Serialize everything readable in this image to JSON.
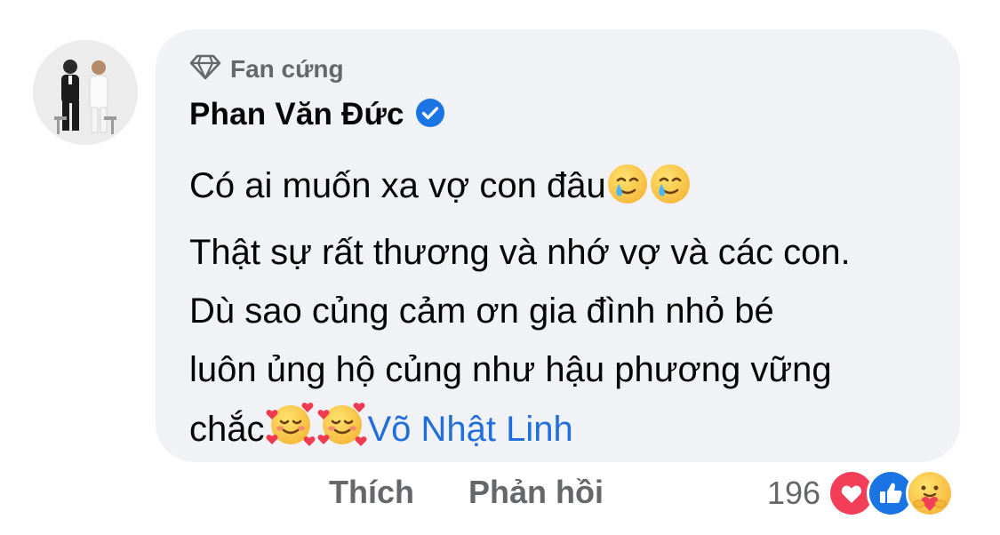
{
  "comment": {
    "badge_label": "Fan cứng",
    "author_name": "Phan Văn Đức",
    "verified": true,
    "lines": [
      "Có ai muốn xa vợ con đâu",
      "Thật sự rất thương và nhớ vợ và các con.",
      "Dù sao củng cảm ơn gia đình nhỏ bé",
      "luôn ủng hộ củng như hậu phương vững",
      "chắc"
    ],
    "line1_emojis": [
      "smiling-face-with-tear",
      "smiling-face-with-tear"
    ],
    "line5_emojis": [
      "smiling-face-with-hearts",
      "smiling-face-with-hearts"
    ],
    "mention": "Võ Nhật Linh"
  },
  "actions": {
    "like_label": "Thích",
    "reply_label": "Phản hồi"
  },
  "reactions": {
    "count": "196",
    "types": [
      "love",
      "like",
      "care"
    ]
  },
  "colors": {
    "bubble_bg": "#f0f2f5",
    "verified_blue": "#1b74e4",
    "mention_blue": "#216fdb",
    "secondary_text": "#65676b",
    "love_red": "#f33e58"
  }
}
